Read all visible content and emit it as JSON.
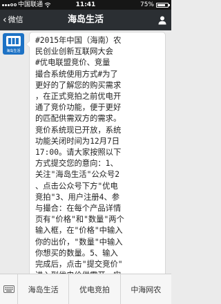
{
  "status_bar": {
    "carrier": "中国联通",
    "time": "11:41",
    "battery_percent": "75%",
    "battery_level": 0.75
  },
  "nav": {
    "back_label": "微信",
    "title": "海岛生活",
    "profile_icon": "person-icon"
  },
  "account": {
    "avatar_logo_text": "海岛生活"
  },
  "message": {
    "lines": [
      "#2015年中国（海南）农",
      "民创业创新互联网大会",
      "#优电联盟竞价、竞量",
      "撮合系统使用方式#为了",
      "更好的了解您的购买需求",
      "，在正式竞拍之前优电开",
      "通了竞价功能，便于更好",
      "的匹配供需双方的需求。",
      "竞价系统现已开放，系统",
      "功能关闭时间为12月7日",
      "17:00。请大家按照以下",
      "方式提交您的意向：1、",
      "关注\"海岛生活\"公众号2",
      "、点击公众号下方\"优电",
      "竞拍\"3、用户注册4、参",
      "与撮合：在每个产品详情",
      "页有\"价格\"和\"数量\"两个",
      "输入框，在\"价格\"中输入",
      "你的出价，\"数量\"中输入",
      "你想买的数量。5、输入",
      "完成后，点击\"提交竞价\"",
      "进入到优电价供需开，实"
    ]
  },
  "bottom_menu": {
    "keyboard_icon": "keyboard-icon",
    "items": [
      "海岛生活",
      "优电竞拍",
      "中海网农"
    ]
  },
  "colors": {
    "nav_bg": "#2b2f33",
    "status_bg": "#161616",
    "chat_bg": "#ebebeb",
    "avatar_bg": "#1d72c5"
  }
}
